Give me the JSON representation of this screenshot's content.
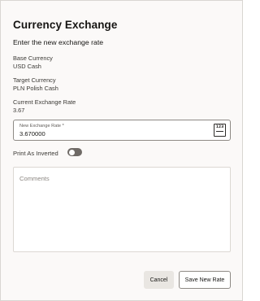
{
  "dialog": {
    "title": "Currency Exchange",
    "subtitle": "Enter the new exchange rate"
  },
  "fields": {
    "base_currency": {
      "label": "Base Currency",
      "value": "USD Cash"
    },
    "target_currency": {
      "label": "Target Currency",
      "value": "PLN Polish Cash"
    },
    "current_rate": {
      "label": "Current Exchange Rate",
      "value": "3.67"
    }
  },
  "new_rate": {
    "label": "New Exchange Rate",
    "required_marker": "*",
    "value": "3.670000",
    "icon": "calculator-icon",
    "icon_text": "123"
  },
  "print_inverted": {
    "label": "Print As Inverted",
    "checked": false
  },
  "comments": {
    "placeholder": "Comments",
    "value": ""
  },
  "buttons": {
    "cancel": "Cancel",
    "save": "Save New Rate"
  }
}
